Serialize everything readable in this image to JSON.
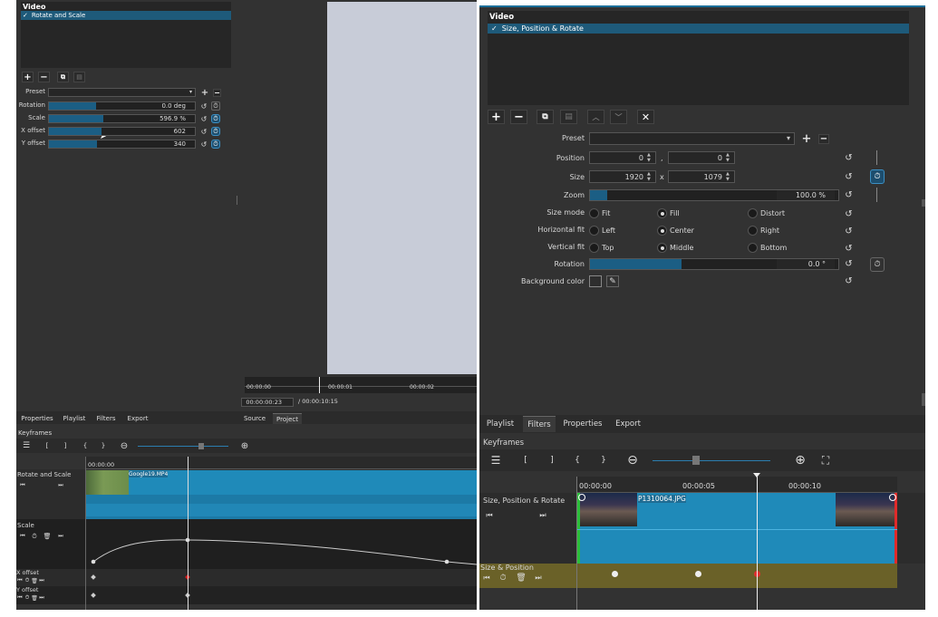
{
  "left": {
    "video_header": "Video",
    "filter_item": "Rotate and Scale",
    "check": "✓",
    "preset_label": "Preset",
    "params": [
      {
        "label": "Rotation",
        "value": "0.0 deg",
        "fill": 0.32
      },
      {
        "label": "Scale",
        "value": "596.9 %",
        "fill": 0.37
      },
      {
        "label": "X offset",
        "value": "602",
        "fill": 0.36
      },
      {
        "label": "Y offset",
        "value": "340",
        "fill": 0.33
      }
    ],
    "tabs": [
      "Properties",
      "Playlist",
      "Filters",
      "Export"
    ],
    "source_tabs": [
      "Source",
      "Project"
    ],
    "ruler": [
      "00:00:00",
      "00:00:01",
      "00:00:02"
    ],
    "timecode": "00:00:00:23",
    "duration": "/ 00:00:10:15",
    "keyframes_title": "Keyframes",
    "kf_ruler": "00:00:00",
    "tracks": [
      "Rotate and Scale",
      "Scale",
      "X offset",
      "Y offset"
    ],
    "clip_name": "Google19.MP4"
  },
  "right": {
    "video_header": "Video",
    "filter_item": "Size, Position & Rotate",
    "check": "✓",
    "preset_label": "Preset",
    "position_label": "Position",
    "position_x": "0",
    "position_y": "0",
    "comma": ",",
    "size_label": "Size",
    "size_w": "1920",
    "size_h": "1079",
    "x_sep": "x",
    "zoom_label": "Zoom",
    "zoom_value": "100.0 %",
    "zoom_fill": 0.07,
    "size_mode_label": "Size mode",
    "size_mode_options": [
      "Fit",
      "Fill",
      "Distort"
    ],
    "size_mode_selected": 1,
    "hfit_label": "Horizontal fit",
    "hfit_options": [
      "Left",
      "Center",
      "Right"
    ],
    "hfit_selected": 1,
    "vfit_label": "Vertical fit",
    "vfit_options": [
      "Top",
      "Middle",
      "Bottom"
    ],
    "vfit_selected": 1,
    "rotation_label": "Rotation",
    "rotation_value": "0.0 °",
    "rotation_fill": 0.37,
    "bgcolor_label": "Background color",
    "tabs": [
      "Playlist",
      "Filters",
      "Properties",
      "Export"
    ],
    "active_tab": 1,
    "keyframes_title": "Keyframes",
    "ruler": [
      "00:00:00",
      "00:00:05",
      "00:00:10"
    ],
    "track_name": "Size, Position & Rotate",
    "clip_name": "P1310064.JPG",
    "param_track": "Size & Position"
  }
}
